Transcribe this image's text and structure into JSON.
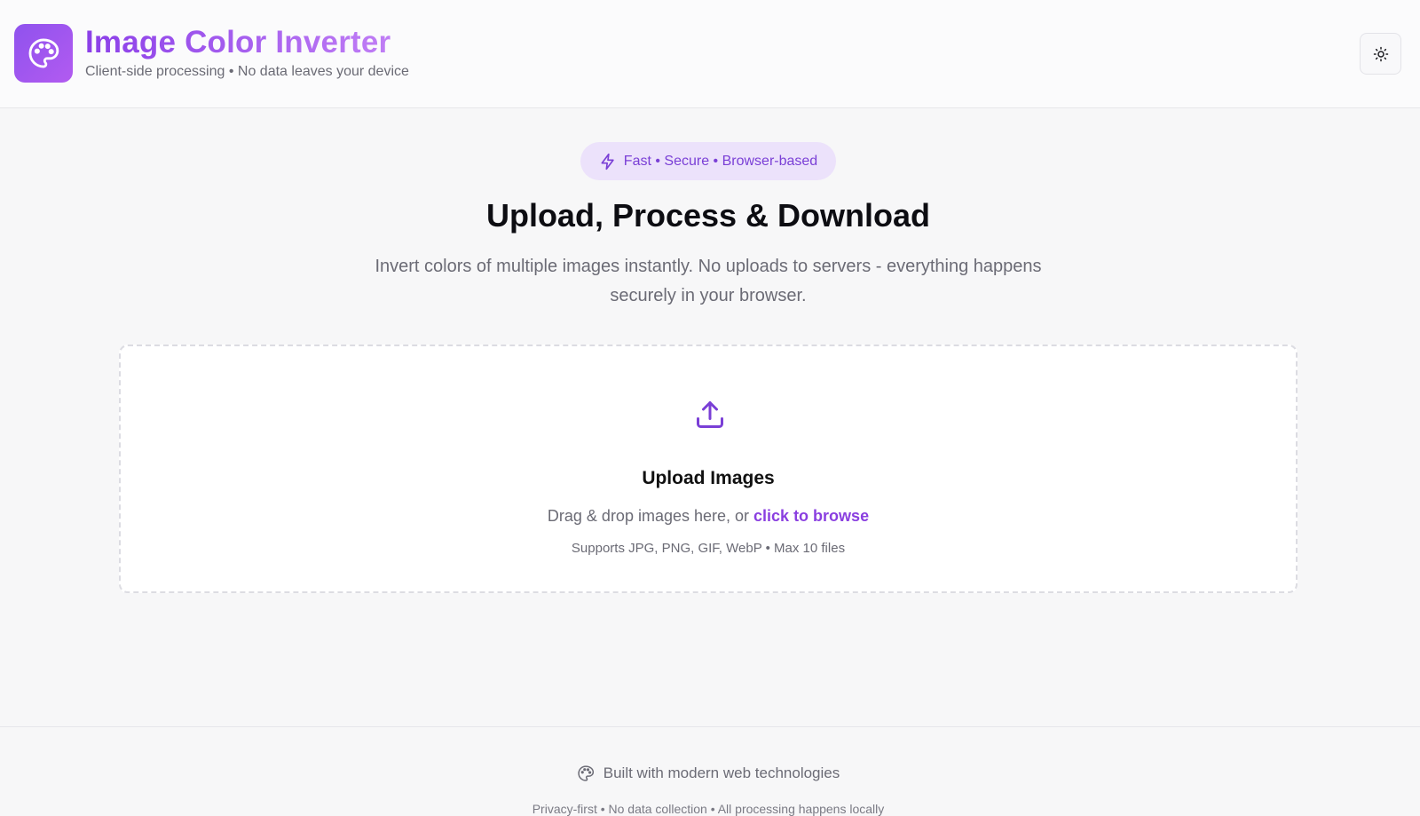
{
  "header": {
    "title": "Image Color Inverter",
    "subtitle": "Client-side processing • No data leaves your device",
    "logo_icon": "palette-icon",
    "theme_toggle_icon": "sun-icon"
  },
  "hero": {
    "badge_text": "Fast • Secure • Browser-based",
    "badge_icon": "lightning-icon",
    "title": "Upload, Process & Download",
    "description": "Invert colors of multiple images instantly. No uploads to servers - everything happens securely in your browser."
  },
  "upload": {
    "icon": "upload-icon",
    "title": "Upload Images",
    "hint_prefix": "Drag & drop images here, or ",
    "browse_link": "click to browse",
    "formats": "Supports JPG, PNG, GIF, WebP • Max 10 files"
  },
  "footer": {
    "icon": "palette-icon",
    "text": "Built with modern web technologies",
    "small_text": "Privacy-first • No data collection • All processing happens locally"
  },
  "colors": {
    "accent": "#8a3fe0",
    "badge_bg": "#ece2fb",
    "logo_gradient_start": "#8f52ee",
    "logo_gradient_end": "#b25bf0"
  }
}
